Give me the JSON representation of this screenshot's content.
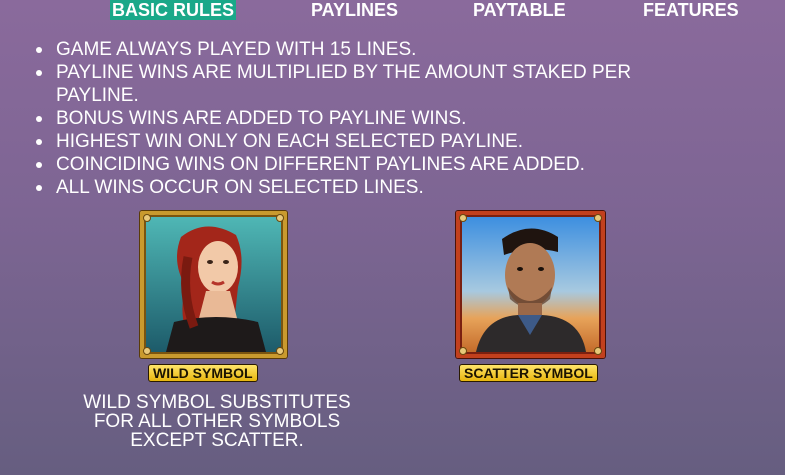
{
  "tabs": [
    {
      "label": "BASIC RULES",
      "active": true
    },
    {
      "label": "PAYLINES",
      "active": false
    },
    {
      "label": "PAYTABLE",
      "active": false
    },
    {
      "label": "FEATURES",
      "active": false
    }
  ],
  "rules": [
    "GAME ALWAYS PLAYED WITH 15 LINES.",
    "PAYLINE WINS ARE MULTIPLIED BY THE AMOUNT STAKED PER PAYLINE.",
    "BONUS WINS ARE ADDED TO PAYLINE WINS.",
    "HIGHEST WIN ONLY ON EACH SELECTED PAYLINE.",
    "COINCIDING WINS ON DIFFERENT PAYLINES ARE ADDED.",
    "ALL WINS OCCUR ON SELECTED LINES."
  ],
  "symbols": {
    "wild": {
      "label": "WILD SYMBOL",
      "description": "WILD SYMBOL SUBSTITUTES FOR ALL OTHER SYMBOLS EXCEPT SCATTER."
    },
    "scatter": {
      "label": "SCATTER SYMBOL"
    }
  },
  "colors": {
    "active_tab": "#1aa889",
    "wild_frame": "#c99a2e",
    "scatter_frame": "#c2401d",
    "label_gold": "#ffe46a"
  }
}
